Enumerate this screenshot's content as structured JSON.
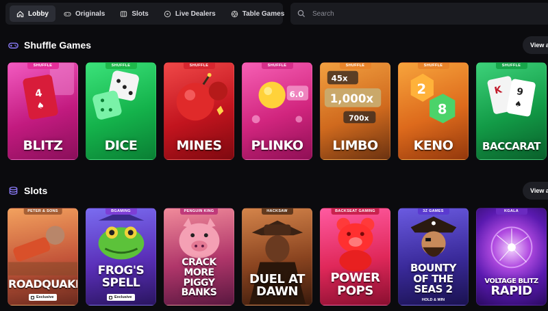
{
  "nav": {
    "items": [
      {
        "label": "Lobby",
        "icon": "home-icon",
        "active": true
      },
      {
        "label": "Originals",
        "icon": "gamepad-icon"
      },
      {
        "label": "Slots",
        "icon": "slots-icon"
      },
      {
        "label": "Live Dealers",
        "icon": "play-circle-icon"
      },
      {
        "label": "Table Games",
        "icon": "chip-icon"
      }
    ]
  },
  "search": {
    "placeholder": "Search",
    "value": ""
  },
  "sections": {
    "shuffle": {
      "title": "Shuffle Games",
      "view_all": "View all",
      "games": [
        {
          "name": "BLITZ",
          "tag": "SHUFFLE",
          "tag_color": "#e52e9a"
        },
        {
          "name": "DICE",
          "tag": "SHUFFLE",
          "tag_color": "#1eb84a"
        },
        {
          "name": "MINES",
          "tag": "SHUFFLE",
          "tag_color": "#d8262f"
        },
        {
          "name": "PLINKO",
          "tag": "SHUFFLE",
          "tag_color": "#d72f8a"
        },
        {
          "name": "LIMBO",
          "tag": "SHUFFLE",
          "tag_color": "#e9842a"
        },
        {
          "name": "KENO",
          "tag": "SHUFFLE",
          "tag_color": "#e9842a"
        },
        {
          "name": "BACCARAT",
          "tag": "SHUFFLE",
          "tag_color": "#17a64a"
        }
      ]
    },
    "slots": {
      "title": "Slots",
      "view_all": "View all",
      "games": [
        {
          "name": "ROADQUAKE",
          "tag": "PETER & SONS",
          "badge": "Exclusive"
        },
        {
          "name": "FROG'S SPELL",
          "tag": "BGAMING",
          "badge": "Exclusive"
        },
        {
          "name": "CRACK MORE PIGGY BANKS",
          "tag": "PENGUIN KING"
        },
        {
          "name": "DUEL AT DAWN",
          "tag": "HACKSAW"
        },
        {
          "name": "POWER POPS",
          "tag": "BACKSEAT GAMING"
        },
        {
          "name": "BOUNTY OF THE SEAS 2",
          "tag": "3Z GAMES",
          "subtitle": "HOLD & WIN"
        },
        {
          "name": "VOLTAGE BLITZ RAPID",
          "tag": "KGALA"
        }
      ]
    }
  },
  "colors": {
    "background": "#0b0b0e",
    "panel": "#1a1b20",
    "accent": "#6f5bf5"
  }
}
